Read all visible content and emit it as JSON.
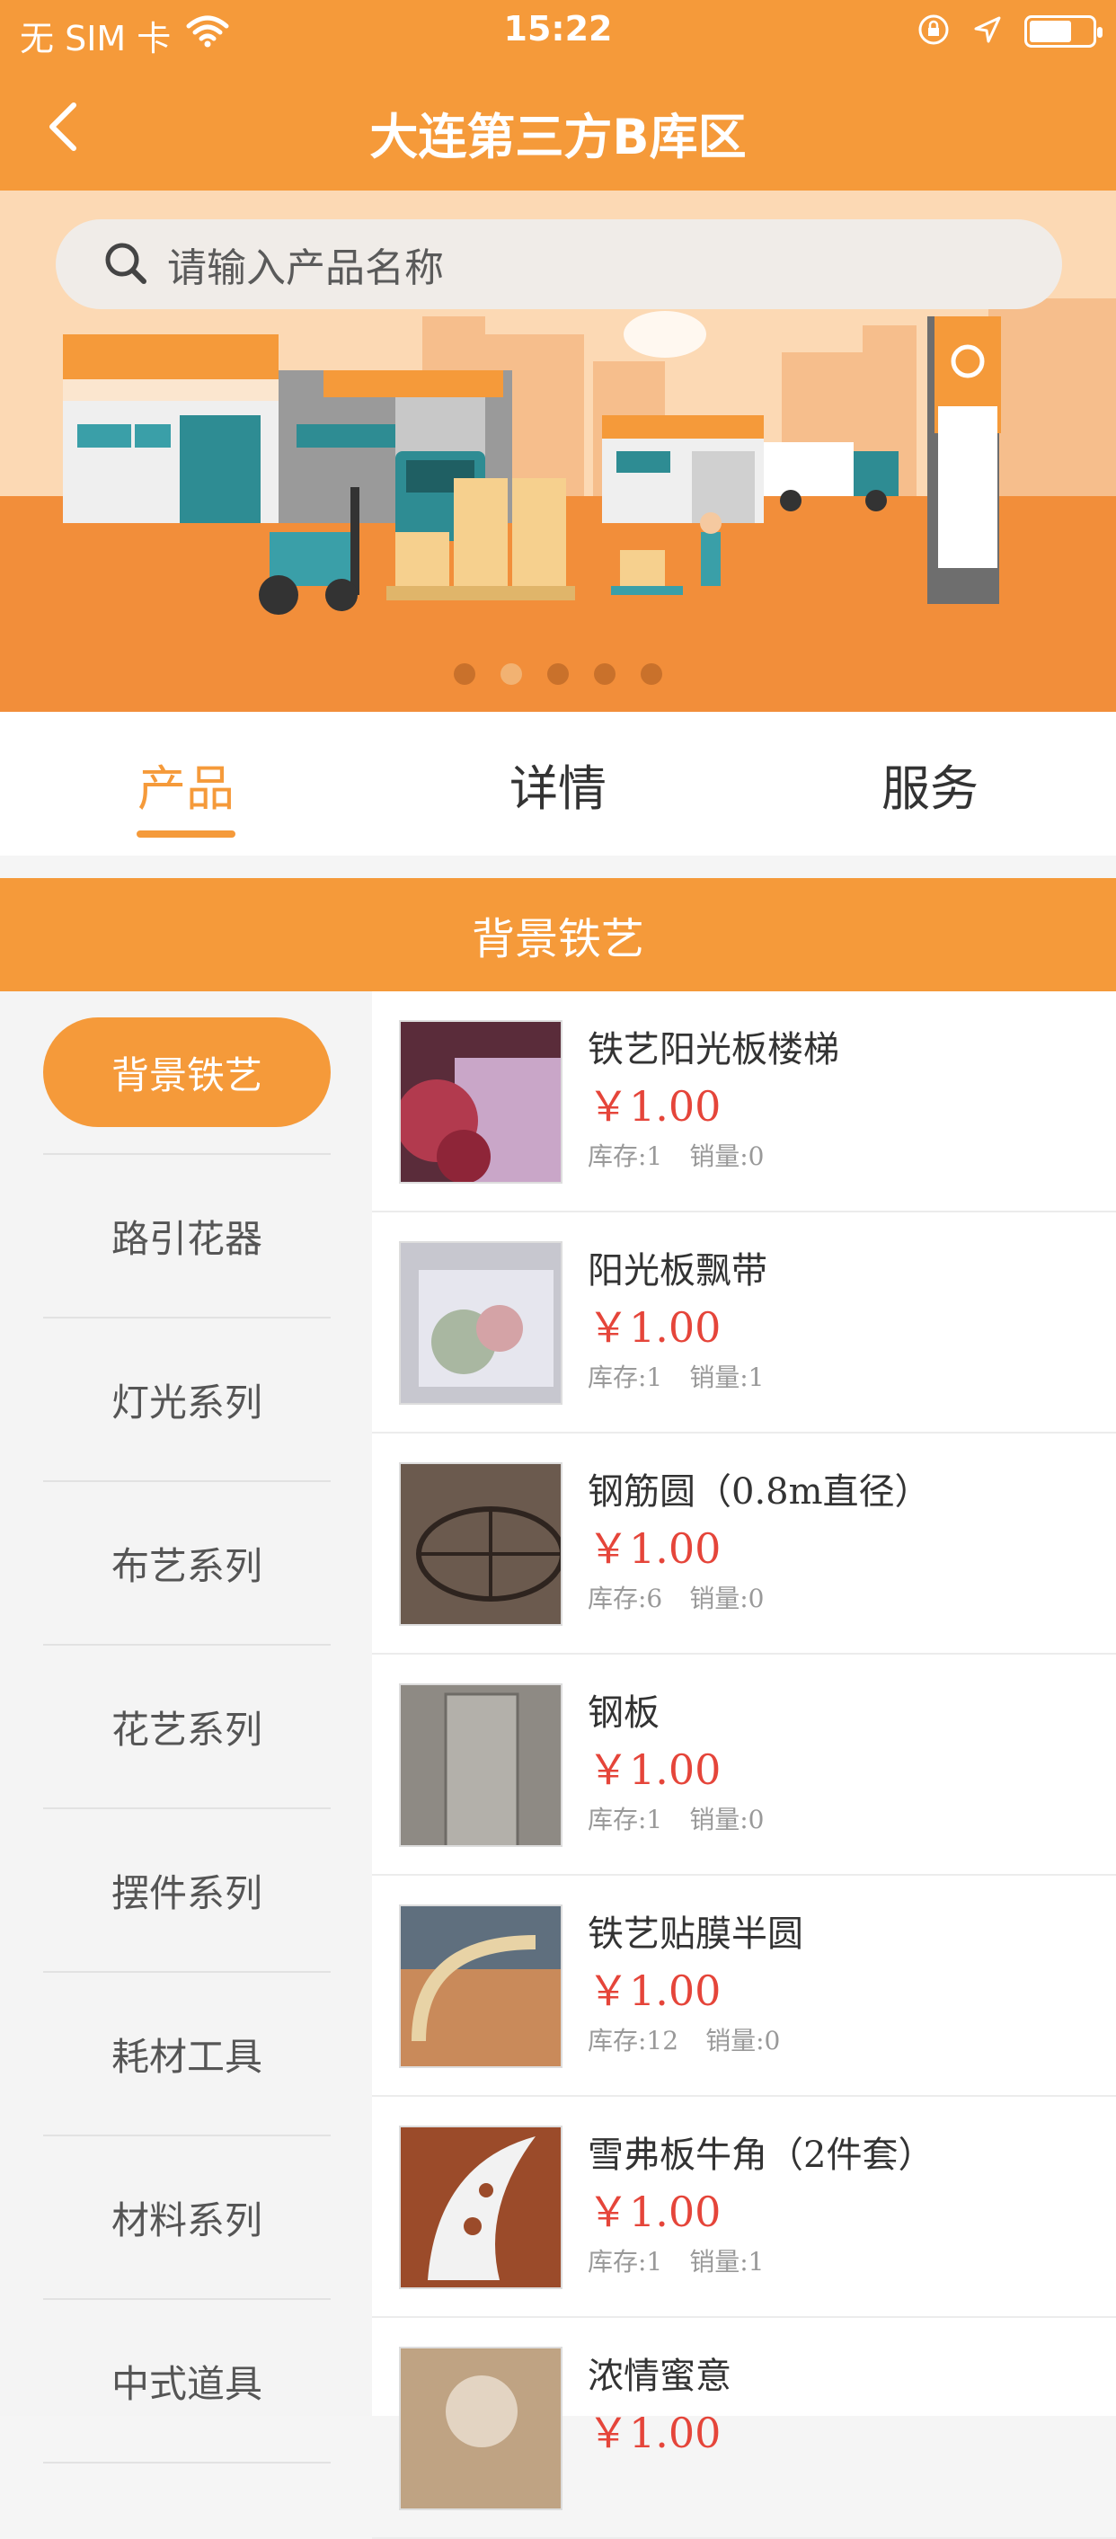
{
  "status": {
    "carrier": "无 SIM 卡",
    "time": "15:22"
  },
  "header": {
    "title": "大连第三方B库区"
  },
  "search": {
    "placeholder": "请输入产品名称"
  },
  "banner": {
    "dots_total": 5,
    "active_dot_index": 1
  },
  "tabs": [
    {
      "label": "产品",
      "active": true
    },
    {
      "label": "详情",
      "active": false
    },
    {
      "label": "服务",
      "active": false
    }
  ],
  "category_title": "背景铁艺",
  "sidebar": {
    "items": [
      {
        "label": "背景铁艺",
        "active": true
      },
      {
        "label": "路引花器"
      },
      {
        "label": "灯光系列"
      },
      {
        "label": "布艺系列"
      },
      {
        "label": "花艺系列"
      },
      {
        "label": "摆件系列"
      },
      {
        "label": "耗材工具"
      },
      {
        "label": "材料系列"
      },
      {
        "label": "中式道具"
      }
    ]
  },
  "products": [
    {
      "name": "铁艺阳光板楼梯",
      "price": "￥1.00",
      "stock": "库存:1",
      "sales": "销量:0"
    },
    {
      "name": "阳光板飘带",
      "price": "￥1.00",
      "stock": "库存:1",
      "sales": "销量:1"
    },
    {
      "name": "钢筋圆（0.8m直径）",
      "price": "￥1.00",
      "stock": "库存:6",
      "sales": "销量:0"
    },
    {
      "name": "钢板",
      "price": "￥1.00",
      "stock": "库存:1",
      "sales": "销量:0"
    },
    {
      "name": "铁艺贴膜半圆",
      "price": "￥1.00",
      "stock": "库存:12",
      "sales": "销量:0"
    },
    {
      "name": "雪弗板牛角（2件套）",
      "price": "￥1.00",
      "stock": "库存:1",
      "sales": "销量:1"
    },
    {
      "name": "浓情蜜意",
      "price": "￥1.00",
      "stock": "",
      "sales": ""
    }
  ],
  "colors": {
    "accent": "#F59A3A",
    "price": "#E5453A"
  }
}
